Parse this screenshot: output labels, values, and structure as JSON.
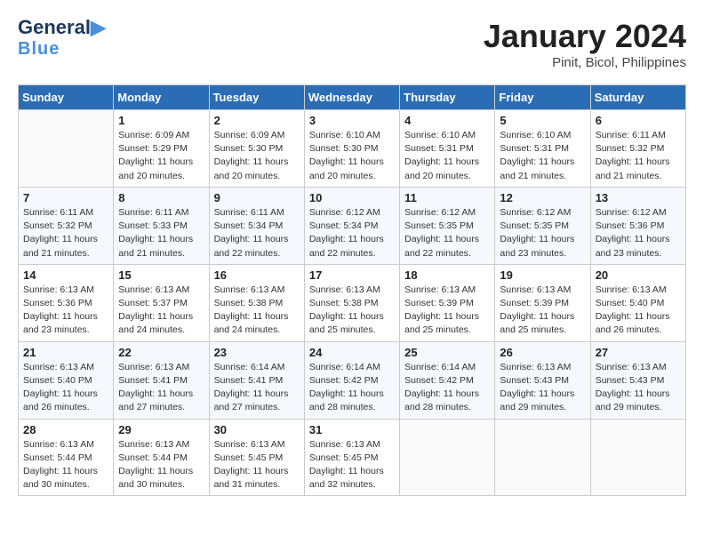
{
  "header": {
    "logo_line1": "General",
    "logo_line2": "Blue",
    "title": "January 2024",
    "subtitle": "Pinit, Bicol, Philippines"
  },
  "columns": [
    "Sunday",
    "Monday",
    "Tuesday",
    "Wednesday",
    "Thursday",
    "Friday",
    "Saturday"
  ],
  "weeks": [
    [
      {
        "day": "",
        "info": ""
      },
      {
        "day": "1",
        "info": "Sunrise: 6:09 AM\nSunset: 5:29 PM\nDaylight: 11 hours\nand 20 minutes."
      },
      {
        "day": "2",
        "info": "Sunrise: 6:09 AM\nSunset: 5:30 PM\nDaylight: 11 hours\nand 20 minutes."
      },
      {
        "day": "3",
        "info": "Sunrise: 6:10 AM\nSunset: 5:30 PM\nDaylight: 11 hours\nand 20 minutes."
      },
      {
        "day": "4",
        "info": "Sunrise: 6:10 AM\nSunset: 5:31 PM\nDaylight: 11 hours\nand 20 minutes."
      },
      {
        "day": "5",
        "info": "Sunrise: 6:10 AM\nSunset: 5:31 PM\nDaylight: 11 hours\nand 21 minutes."
      },
      {
        "day": "6",
        "info": "Sunrise: 6:11 AM\nSunset: 5:32 PM\nDaylight: 11 hours\nand 21 minutes."
      }
    ],
    [
      {
        "day": "7",
        "info": "Sunrise: 6:11 AM\nSunset: 5:32 PM\nDaylight: 11 hours\nand 21 minutes."
      },
      {
        "day": "8",
        "info": "Sunrise: 6:11 AM\nSunset: 5:33 PM\nDaylight: 11 hours\nand 21 minutes."
      },
      {
        "day": "9",
        "info": "Sunrise: 6:11 AM\nSunset: 5:34 PM\nDaylight: 11 hours\nand 22 minutes."
      },
      {
        "day": "10",
        "info": "Sunrise: 6:12 AM\nSunset: 5:34 PM\nDaylight: 11 hours\nand 22 minutes."
      },
      {
        "day": "11",
        "info": "Sunrise: 6:12 AM\nSunset: 5:35 PM\nDaylight: 11 hours\nand 22 minutes."
      },
      {
        "day": "12",
        "info": "Sunrise: 6:12 AM\nSunset: 5:35 PM\nDaylight: 11 hours\nand 23 minutes."
      },
      {
        "day": "13",
        "info": "Sunrise: 6:12 AM\nSunset: 5:36 PM\nDaylight: 11 hours\nand 23 minutes."
      }
    ],
    [
      {
        "day": "14",
        "info": "Sunrise: 6:13 AM\nSunset: 5:36 PM\nDaylight: 11 hours\nand 23 minutes."
      },
      {
        "day": "15",
        "info": "Sunrise: 6:13 AM\nSunset: 5:37 PM\nDaylight: 11 hours\nand 24 minutes."
      },
      {
        "day": "16",
        "info": "Sunrise: 6:13 AM\nSunset: 5:38 PM\nDaylight: 11 hours\nand 24 minutes."
      },
      {
        "day": "17",
        "info": "Sunrise: 6:13 AM\nSunset: 5:38 PM\nDaylight: 11 hours\nand 25 minutes."
      },
      {
        "day": "18",
        "info": "Sunrise: 6:13 AM\nSunset: 5:39 PM\nDaylight: 11 hours\nand 25 minutes."
      },
      {
        "day": "19",
        "info": "Sunrise: 6:13 AM\nSunset: 5:39 PM\nDaylight: 11 hours\nand 25 minutes."
      },
      {
        "day": "20",
        "info": "Sunrise: 6:13 AM\nSunset: 5:40 PM\nDaylight: 11 hours\nand 26 minutes."
      }
    ],
    [
      {
        "day": "21",
        "info": "Sunrise: 6:13 AM\nSunset: 5:40 PM\nDaylight: 11 hours\nand 26 minutes."
      },
      {
        "day": "22",
        "info": "Sunrise: 6:13 AM\nSunset: 5:41 PM\nDaylight: 11 hours\nand 27 minutes."
      },
      {
        "day": "23",
        "info": "Sunrise: 6:14 AM\nSunset: 5:41 PM\nDaylight: 11 hours\nand 27 minutes."
      },
      {
        "day": "24",
        "info": "Sunrise: 6:14 AM\nSunset: 5:42 PM\nDaylight: 11 hours\nand 28 minutes."
      },
      {
        "day": "25",
        "info": "Sunrise: 6:14 AM\nSunset: 5:42 PM\nDaylight: 11 hours\nand 28 minutes."
      },
      {
        "day": "26",
        "info": "Sunrise: 6:13 AM\nSunset: 5:43 PM\nDaylight: 11 hours\nand 29 minutes."
      },
      {
        "day": "27",
        "info": "Sunrise: 6:13 AM\nSunset: 5:43 PM\nDaylight: 11 hours\nand 29 minutes."
      }
    ],
    [
      {
        "day": "28",
        "info": "Sunrise: 6:13 AM\nSunset: 5:44 PM\nDaylight: 11 hours\nand 30 minutes."
      },
      {
        "day": "29",
        "info": "Sunrise: 6:13 AM\nSunset: 5:44 PM\nDaylight: 11 hours\nand 30 minutes."
      },
      {
        "day": "30",
        "info": "Sunrise: 6:13 AM\nSunset: 5:45 PM\nDaylight: 11 hours\nand 31 minutes."
      },
      {
        "day": "31",
        "info": "Sunrise: 6:13 AM\nSunset: 5:45 PM\nDaylight: 11 hours\nand 32 minutes."
      },
      {
        "day": "",
        "info": ""
      },
      {
        "day": "",
        "info": ""
      },
      {
        "day": "",
        "info": ""
      }
    ]
  ]
}
